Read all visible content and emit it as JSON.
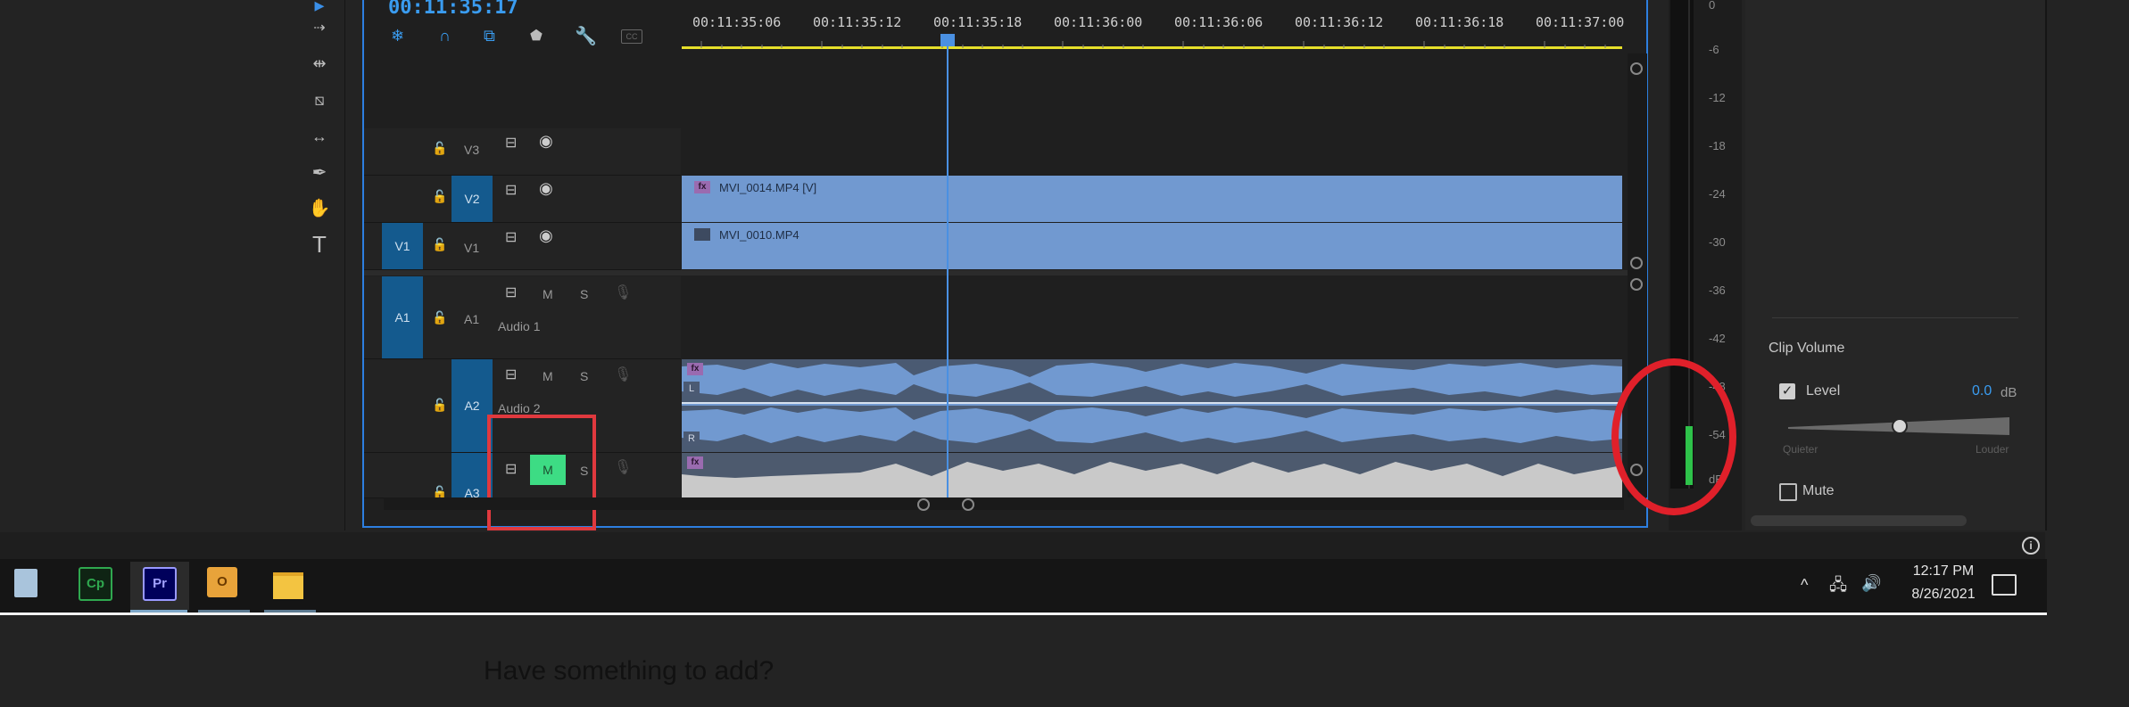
{
  "timeline": {
    "timecode": "00:11:35:17",
    "ruler_ticks": [
      "00:11:35:06",
      "00:11:35:12",
      "00:11:35:18",
      "00:11:36:00",
      "00:11:36:06",
      "00:11:36:12",
      "00:11:36:18",
      "00:11:37:00"
    ],
    "tracks": {
      "v3": {
        "label": "V3"
      },
      "v2": {
        "label": "V2"
      },
      "v1": {
        "label": "V1",
        "source": "V1"
      },
      "a1": {
        "label": "A1",
        "source": "A1",
        "name": "Audio 1",
        "mute": "M",
        "solo": "S"
      },
      "a2": {
        "label": "A2",
        "name": "Audio 2",
        "mute": "M",
        "solo": "S"
      },
      "a3": {
        "label": "A3",
        "mute": "M",
        "solo": "S"
      }
    },
    "clips": {
      "v2_clip": "MVI_0014.MP4 [V]",
      "v1_clip": "MVI_0010.MP4",
      "fx_badge": "fx",
      "ch_left": "L",
      "ch_right": "R"
    },
    "colors": {
      "panel_border": "#2d7fe0",
      "clip_blue": "#7199d0",
      "playhead": "#4a90e2",
      "highlight_box": "#e0393e",
      "mute_active": "#3ddc84"
    }
  },
  "meter": {
    "scale": [
      "0",
      "-6",
      "-12",
      "-18",
      "-24",
      "-30",
      "-36",
      "-42",
      "-48",
      "-54",
      "dB"
    ],
    "level_fraction": 0.12
  },
  "effect_controls": {
    "section": "Clip Volume",
    "level_label": "Level",
    "level_value": "0.0",
    "level_unit": "dB",
    "quieter": "Quieter",
    "louder": "Louder",
    "mute_label": "Mute"
  },
  "taskbar": {
    "apps": [
      {
        "name": "Cp",
        "color": "#2fa84f"
      },
      {
        "name": "Pr",
        "color": "#00005b"
      },
      {
        "name": "Outlook",
        "color": "#e8a33a"
      },
      {
        "name": "Explorer",
        "color": "#f3c441"
      }
    ],
    "time": "12:17 PM",
    "date": "8/26/2021"
  },
  "footer_prompt": "Have something to add?"
}
